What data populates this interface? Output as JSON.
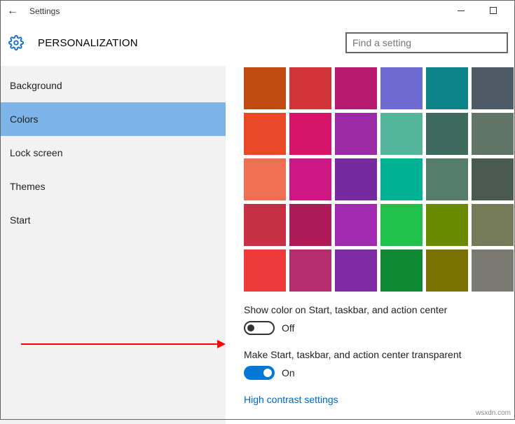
{
  "window": {
    "title": "Settings"
  },
  "header": {
    "title": "PERSONALIZATION",
    "search_placeholder": "Find a setting"
  },
  "sidebar": {
    "items": [
      {
        "label": "Background",
        "active": false
      },
      {
        "label": "Colors",
        "active": true
      },
      {
        "label": "Lock screen",
        "active": false
      },
      {
        "label": "Themes",
        "active": false
      },
      {
        "label": "Start",
        "active": false
      }
    ]
  },
  "colors": {
    "swatches": [
      "#c04a12",
      "#d13538",
      "#b71a6f",
      "#6d6bd2",
      "#0c8387",
      "#4d5b66",
      "#e84a27",
      "#d6156a",
      "#9a2aa6",
      "#53b59b",
      "#3f6a5e",
      "#5e7567",
      "#ef7055",
      "#cd1784",
      "#762a9d",
      "#00b294",
      "#567c6b",
      "#4a5a50",
      "#c73044",
      "#b01a56",
      "#a12ab0",
      "#1fc14a",
      "#6a8a00",
      "#757b59",
      "#ee3a3a",
      "#b52d6f",
      "#7c2aa1",
      "#0f8a33",
      "#7b7100",
      "#7a7a72"
    ]
  },
  "settings": {
    "showColor": {
      "label": "Show color on Start, taskbar, and action center",
      "state": "Off",
      "on": false
    },
    "transparent": {
      "label": "Make Start, taskbar, and action center transparent",
      "state": "On",
      "on": true
    },
    "highContrast": {
      "label": "High contrast settings"
    }
  },
  "watermark": "wsxdn.com"
}
